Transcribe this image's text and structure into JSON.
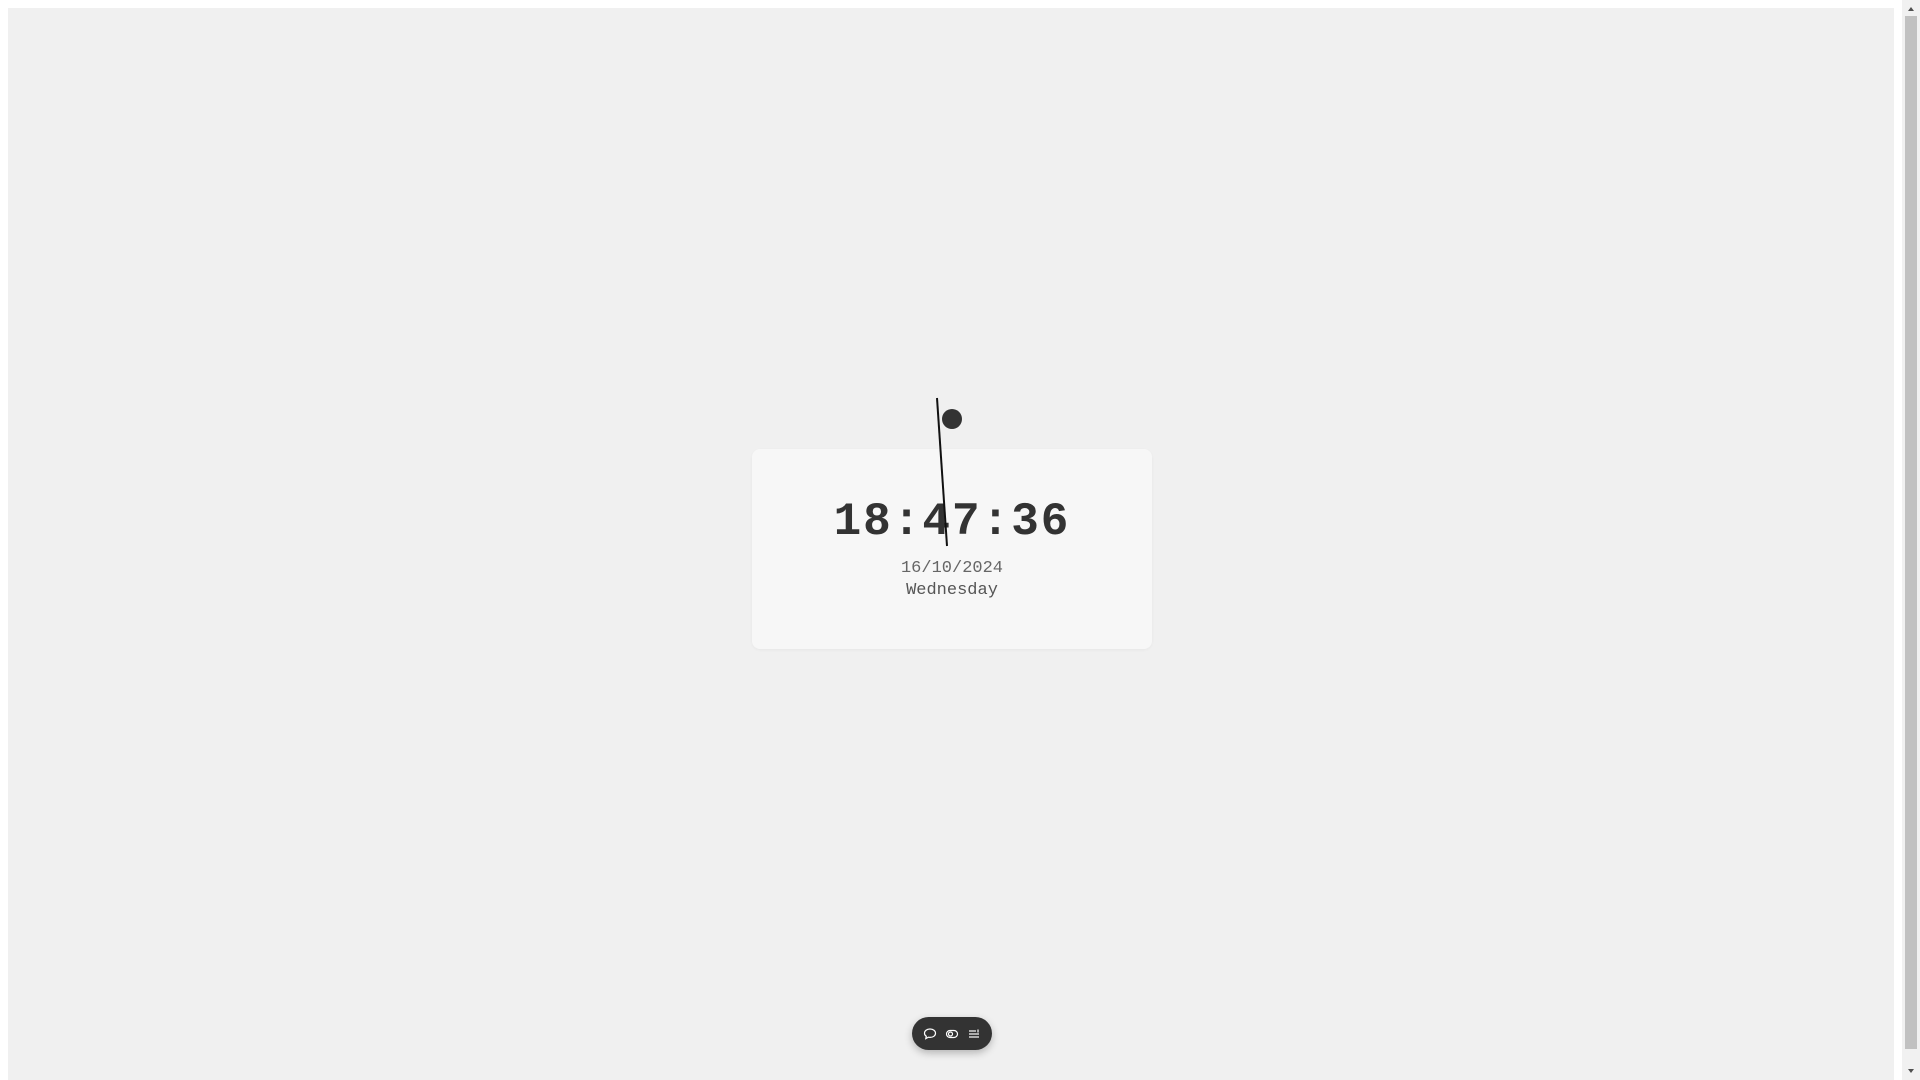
{
  "clock": {
    "time": "18:47:36",
    "date": "16/10/2024",
    "weekday": "Wednesday"
  },
  "dock": {
    "buttons": [
      {
        "icon": "chat-bubble-icon"
      },
      {
        "icon": "toggle-theme-icon"
      },
      {
        "icon": "menu-list-icon"
      }
    ]
  },
  "colors": {
    "background": "#f0f0f0",
    "card": "#f7f7f7",
    "text": "#333333",
    "dock": "#333333",
    "pendulum": "#333333"
  }
}
